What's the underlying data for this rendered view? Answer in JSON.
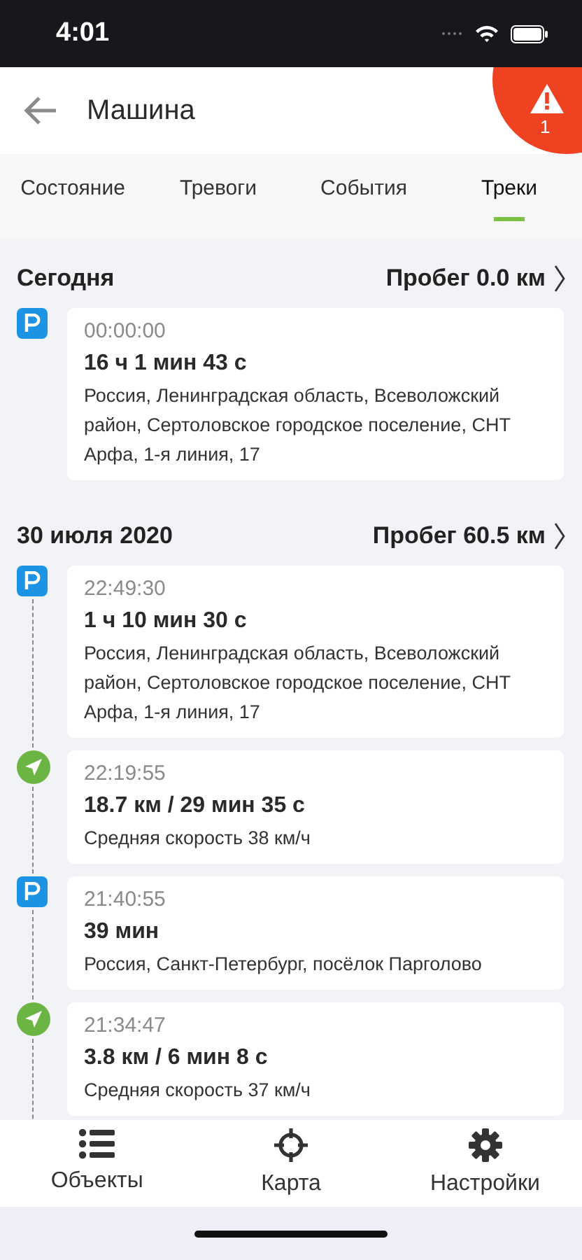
{
  "status_bar": {
    "time": "4:01"
  },
  "header": {
    "title": "Машина",
    "alarm_count": "1"
  },
  "tabs": [
    {
      "label": "Состояние",
      "selected": false
    },
    {
      "label": "Тревоги",
      "selected": false
    },
    {
      "label": "События",
      "selected": false
    },
    {
      "label": "Треки",
      "selected": true
    }
  ],
  "days": [
    {
      "date": "Сегодня",
      "mileage": "Пробег 0.0 км",
      "entries": [
        {
          "kind": "parking",
          "time": "00:00:00",
          "summary": "16 ч 1 мин 43 с",
          "detail": "Россия, Ленинградская область, Всеволожский район, Сертоловское городское поселение, СНТ Арфа, 1-я линия, 17"
        }
      ]
    },
    {
      "date": "30 июля 2020",
      "mileage": "Пробег 60.5 км",
      "entries": [
        {
          "kind": "parking",
          "time": "22:49:30",
          "summary": "1 ч 10 мин 30 с",
          "detail": "Россия, Ленинградская область, Всеволожский район, Сертоловское городское поселение, СНТ Арфа, 1-я линия, 17"
        },
        {
          "kind": "drive",
          "time": "22:19:55",
          "summary": "18.7 км / 29 мин 35 с",
          "detail": "Средняя скорость 38 км/ч"
        },
        {
          "kind": "parking",
          "time": "21:40:55",
          "summary": "39 мин",
          "detail": "Россия, Санкт-Петербург, посёлок Парголово"
        },
        {
          "kind": "drive",
          "time": "21:34:47",
          "summary": "3.8 км / 6 мин 8 с",
          "detail": "Средняя скорость 37 км/ч"
        }
      ]
    }
  ],
  "bottom_nav": [
    {
      "label": "Объекты"
    },
    {
      "label": "Карта"
    },
    {
      "label": "Настройки"
    }
  ]
}
